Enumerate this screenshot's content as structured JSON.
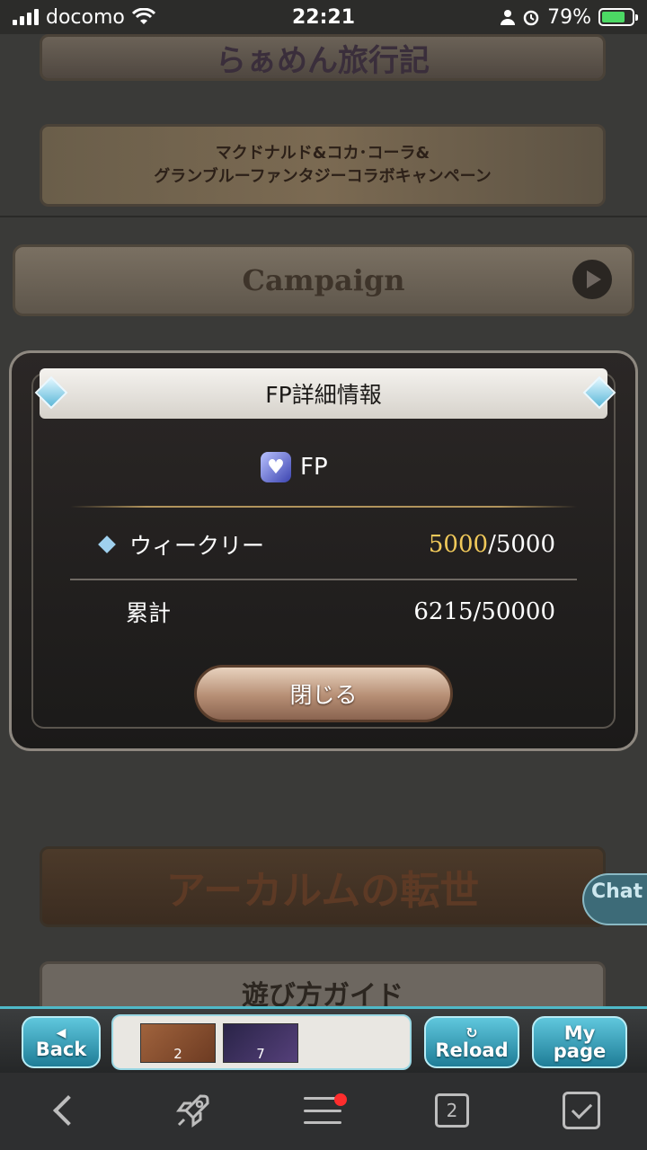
{
  "status_bar": {
    "carrier": "docomo",
    "time": "22:21",
    "battery": "79%"
  },
  "banners": {
    "ramen": "らぁめん旅行記",
    "mcd_line1": "マクドナルド&コカ･コーラ&",
    "mcd_line2": "グランブルーファンタジーコラボキャンペーン",
    "campaign": "Campaign",
    "arcarum": "アーカルムの転世",
    "guide": "遊び方ガイド",
    "chat": "Chat"
  },
  "modal": {
    "title": "FP詳細情報",
    "fp_label": "FP",
    "weekly": {
      "label": "ウィークリー",
      "current": "5000",
      "max": "/5000"
    },
    "total": {
      "label": "累計",
      "value": "6215/50000"
    },
    "close": "閉じる"
  },
  "game_bar": {
    "back": "Back",
    "reload": "Reload",
    "mypage_line1": "My",
    "mypage_line2": "page",
    "slot1_count": "2",
    "slot2_count": "7"
  },
  "browser_toolbar": {
    "tab_count": "2"
  },
  "colors": {
    "accent": "#4fb9c8",
    "highlight": "#f1c95a",
    "notification": "#ff2d2d"
  }
}
